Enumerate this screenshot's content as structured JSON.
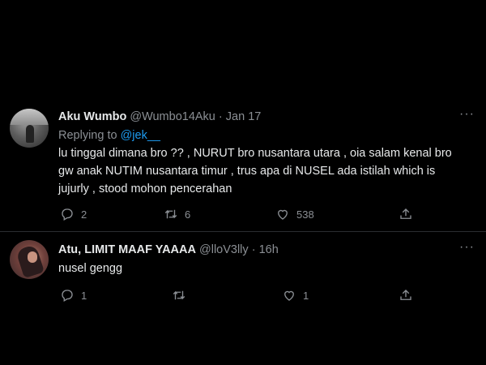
{
  "tweets": [
    {
      "name": "Aku Wumbo",
      "handle": "@Wumbo14Aku",
      "dot": "·",
      "date": "Jan 17",
      "more": "···",
      "replying_prefix": "Replying to ",
      "replying_to": "@jek__",
      "text_lines": [
        "lu tinggal dimana bro ?? , NURUT bro nusantara utara , oia salam kenal bro",
        "gw anak NUTIM nusantara timur , trus apa di NUSEL ada istilah which is",
        "jujurly , stood mohon pencerahan"
      ],
      "actions": {
        "reply": "2",
        "retweet": "6",
        "like": "538"
      }
    },
    {
      "name": "Atu, LIMIT MAAF YAAAA",
      "handle": "@lloV3lly",
      "dot": "·",
      "date": "16h",
      "more": "···",
      "text_lines": [
        "nusel gengg"
      ],
      "actions": {
        "reply": "1",
        "retweet": "",
        "like": "1"
      }
    }
  ],
  "colors": {
    "background": "#000000",
    "text": "#e7e9ea",
    "muted": "#8b8f94",
    "accent": "#1d9bf0"
  },
  "icons": [
    "reply-icon",
    "retweet-icon",
    "like-icon",
    "share-icon",
    "more-icon"
  ]
}
